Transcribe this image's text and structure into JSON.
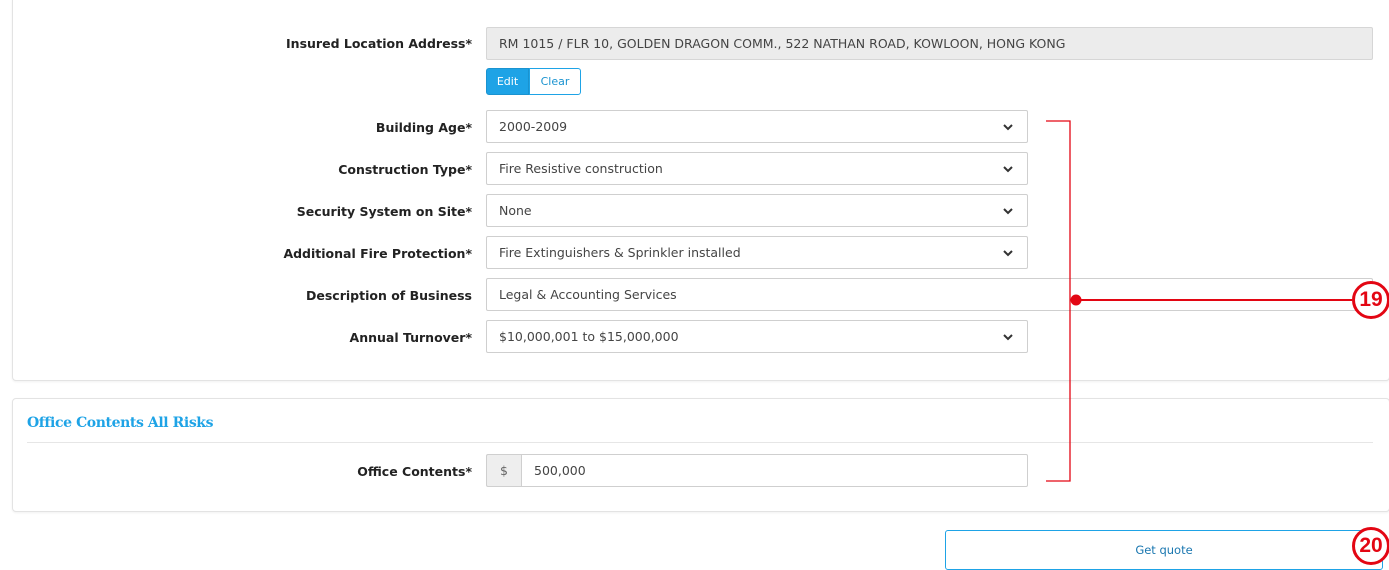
{
  "location": {
    "address_label": "Insured Location Address*",
    "address_value": "RM 1015 / FLR 10, GOLDEN DRAGON COMM., 522 NATHAN ROAD, KOWLOON, HONG KONG",
    "edit_label": "Edit",
    "clear_label": "Clear",
    "building_age": {
      "label": "Building Age*",
      "value": "2000-2009"
    },
    "construction_type": {
      "label": "Construction Type*",
      "value": "Fire Resistive construction"
    },
    "security_system": {
      "label": "Security System on Site*",
      "value": "None"
    },
    "fire_protection": {
      "label": "Additional Fire Protection*",
      "value": "Fire Extinguishers & Sprinkler installed"
    },
    "business_description": {
      "label": "Description of Business",
      "value": "Legal & Accounting Services"
    },
    "annual_turnover": {
      "label": "Annual Turnover*",
      "value": "$10,000,001 to $15,000,000"
    }
  },
  "office_contents": {
    "section_title": "Office Contents All Risks",
    "label": "Office Contents*",
    "currency_symbol": "$",
    "value": "500,000"
  },
  "actions": {
    "get_quote_label": "Get quote"
  },
  "annotations": {
    "badge_19": "19",
    "badge_20": "20",
    "color": "#e30613"
  },
  "icons": {
    "dropdown": "chevron-down-icon"
  },
  "colors": {
    "accent": "#1ea3e6",
    "annotation": "#e30613"
  }
}
